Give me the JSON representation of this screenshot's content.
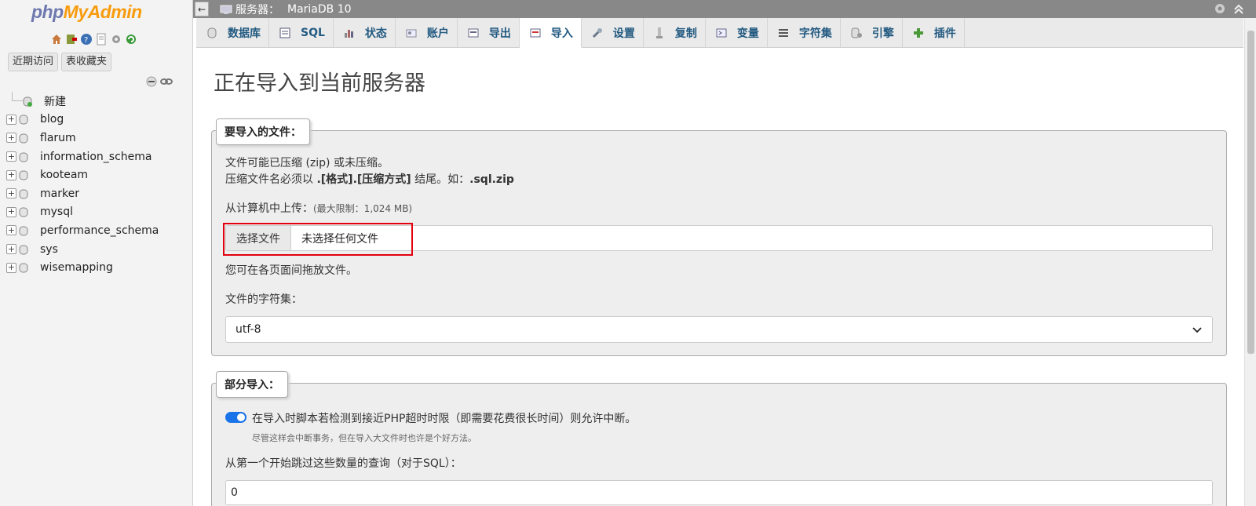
{
  "sidebar": {
    "logo_part1": "php",
    "logo_part2": "MyAdmin",
    "tabs": [
      "近期访问",
      "表收藏夹"
    ],
    "tree": {
      "new_label": "新建",
      "databases": [
        "blog",
        "flarum",
        "information_schema",
        "kooteam",
        "marker",
        "mysql",
        "performance_schema",
        "sys",
        "wisemapping"
      ]
    }
  },
  "topbar": {
    "server_label": "服务器：",
    "server_name": "MariaDB 10"
  },
  "tabs": [
    "数据库",
    "SQL",
    "状态",
    "账户",
    "导出",
    "导入",
    "设置",
    "复制",
    "变量",
    "字符集",
    "引擎",
    "插件"
  ],
  "active_tab": "导入",
  "main": {
    "title": "正在导入到当前服务器",
    "file_section": {
      "legend": "要导入的文件：",
      "line1": "文件可能已压缩 (zip) 或未压缩。",
      "line2_prefix": "压缩文件名必须以 ",
      "line2_bold": ".[格式].[压缩方式]",
      "line2_mid": " 结尾。如：",
      "line2_example": ".sql.zip",
      "upload_label": "从计算机中上传：",
      "upload_limit": "(最大限制：1,024 MB)",
      "choose_button": "选择文件",
      "no_file": "未选择任何文件",
      "drag_hint": "您可在各页面间拖放文件。",
      "charset_label": "文件的字符集：",
      "charset_value": "utf-8"
    },
    "partial_section": {
      "legend": "部分导入：",
      "allow_interrupt": "在导入时脚本若检测到接近PHP超时时限（即需要花费很长时间）则允许中断。",
      "allow_interrupt_note": "尽管这样会中断事务，但在导入大文件时也许是个好方法。",
      "allow_interrupt_enabled": true,
      "skip_label": "从第一个开始跳过这些数量的查询（对于SQL）：",
      "skip_value": "0"
    }
  },
  "colors": {
    "accent": "#235a81",
    "toggle": "#1a73e8",
    "highlight": "#e3000f",
    "topbar": "#888888"
  }
}
